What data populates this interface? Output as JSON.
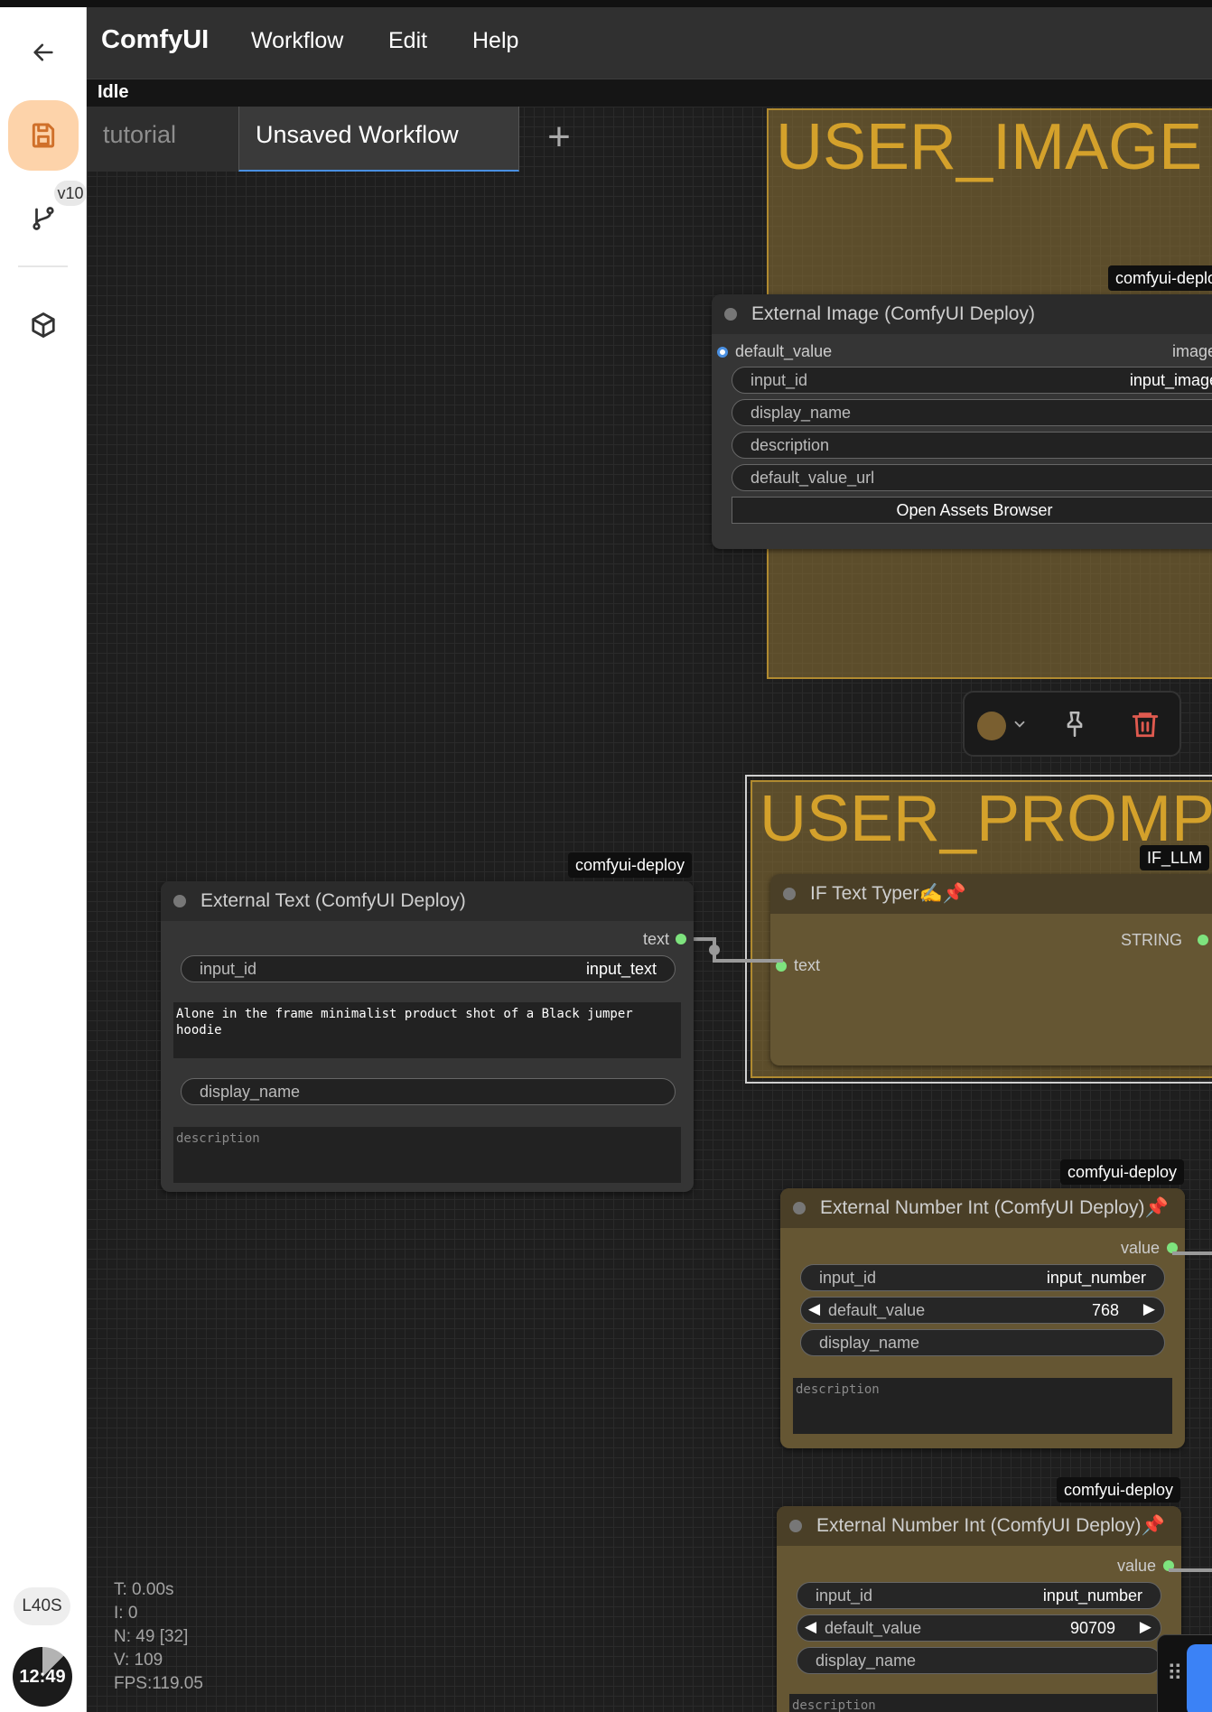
{
  "app": {
    "logo": "ComfyUI",
    "menu": [
      "Workflow",
      "Edit",
      "Help"
    ],
    "status": "Idle"
  },
  "sidebar": {
    "version_badge": "v10",
    "gpu": "L40S",
    "timer": "12:49"
  },
  "tabs": [
    {
      "label": "tutorial",
      "active": false
    },
    {
      "label": "Unsaved Workflow",
      "active": true
    }
  ],
  "add_tab": "+",
  "groups": {
    "image": "USER_IMAGE",
    "prompt": "USER_PROMPT"
  },
  "tags": {
    "image_node": "comfyui-deplo",
    "text_node": "comfyui-deploy",
    "typer_node": "IF_LLM",
    "num1_node": "comfyui-deploy",
    "num2_node": "comfyui-deploy"
  },
  "nodes": {
    "external_image": {
      "title": "External Image (ComfyUI Deploy)",
      "input_slot": "default_value",
      "output_slot": "image",
      "widgets": [
        {
          "label": "input_id",
          "value": "input_image"
        },
        {
          "label": "display_name",
          "value": ""
        },
        {
          "label": "description",
          "value": ""
        },
        {
          "label": "default_value_url",
          "value": ""
        }
      ],
      "button": "Open Assets Browser"
    },
    "external_text": {
      "title": "External Text (ComfyUI Deploy)",
      "output_slot": "text",
      "input_id_label": "input_id",
      "input_id_value": "input_text",
      "text_value": "Alone in the frame minimalist product shot of a Black jumper hoodie",
      "display_name": "display_name",
      "description_placeholder": "description"
    },
    "text_typer": {
      "title": "IF Text Typer✍️📌",
      "input_slot": "text",
      "output_slot": "STRING"
    },
    "number1": {
      "title": "External Number Int (ComfyUI Deploy)📌",
      "output_slot": "value",
      "input_id_label": "input_id",
      "input_id_value": "input_number",
      "default_label": "default_value",
      "default_value": "768",
      "display_name": "display_name",
      "description_placeholder": "description"
    },
    "number2": {
      "title": "External Number Int (ComfyUI Deploy)📌",
      "output_slot": "value",
      "input_id_label": "input_id",
      "input_id_value": "input_number",
      "default_label": "default_value",
      "default_value": "90709",
      "display_name": "display_name",
      "description_placeholder": "description"
    }
  },
  "stats": {
    "t": "T: 0.00s",
    "i": "I: 0",
    "n": "N: 49 [32]",
    "v": "V: 109",
    "fps": "FPS:119.05"
  },
  "colors": {
    "accent": "#4a90e2",
    "group_fill": "#826a34",
    "group_title": "#d4a12b",
    "save_bg": "#fdd3aa",
    "danger": "#e05a4f",
    "slot_green": "#7ee37e"
  },
  "icons": [
    "back-arrow-icon",
    "save-icon",
    "branch-icon",
    "cube-icon",
    "chevron-down-icon",
    "pin-icon",
    "trash-icon",
    "drag-handle-icon"
  ]
}
